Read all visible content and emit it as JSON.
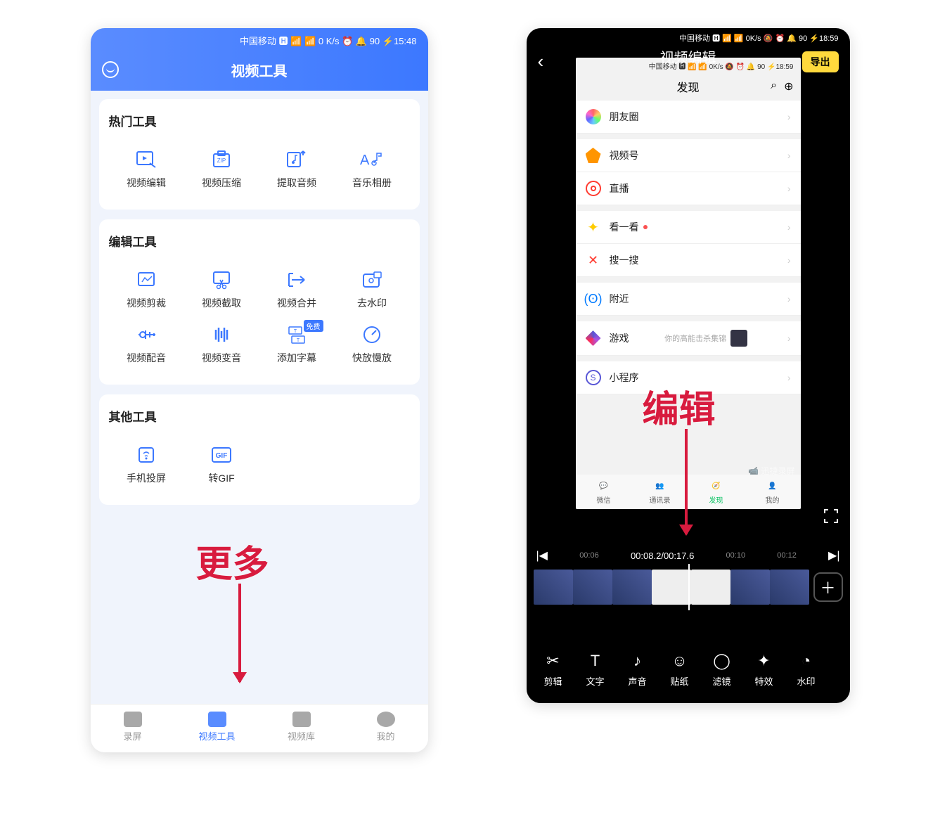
{
  "left": {
    "status_bar": "中国移动 🅷 📶 📶 0 K/s    ⏰ 🔔 90 ⚡15:48",
    "header_title": "视频工具",
    "sections": [
      {
        "title": "热门工具",
        "items": [
          {
            "label": "视频编辑",
            "icon": "video-edit"
          },
          {
            "label": "视频压缩",
            "icon": "zip"
          },
          {
            "label": "提取音频",
            "icon": "music-extract"
          },
          {
            "label": "音乐相册",
            "icon": "album"
          }
        ]
      },
      {
        "title": "编辑工具",
        "items": [
          {
            "label": "视频剪裁",
            "icon": "crop"
          },
          {
            "label": "视频截取",
            "icon": "cut"
          },
          {
            "label": "视频合并",
            "icon": "merge"
          },
          {
            "label": "去水印",
            "icon": "watermark"
          },
          {
            "label": "视频配音",
            "icon": "dub"
          },
          {
            "label": "视频变音",
            "icon": "voice"
          },
          {
            "label": "添加字幕",
            "icon": "subtitle",
            "badge": "免费"
          },
          {
            "label": "快放慢放",
            "icon": "speed"
          }
        ]
      },
      {
        "title": "其他工具",
        "items": [
          {
            "label": "手机投屏",
            "icon": "cast"
          },
          {
            "label": "转GIF",
            "icon": "gif"
          }
        ]
      }
    ],
    "annotation": "更多",
    "bottom_nav": [
      {
        "label": "录屏",
        "active": false
      },
      {
        "label": "视频工具",
        "active": true
      },
      {
        "label": "视频库",
        "active": false
      },
      {
        "label": "我的",
        "active": false
      }
    ]
  },
  "right": {
    "status_bar": "中国移动 🅷 📶 📶 0K/s 🔕 ⏰ 🔔 90 ⚡18:59",
    "header_title": "视频编辑",
    "export_label": "导出",
    "preview": {
      "wx_header": "发现",
      "items": [
        {
          "label": "朋友圈",
          "color": "linear-gradient(45deg,#f66,#6cf,#6f6,#fc6)"
        },
        {
          "label": "视频号",
          "color": "#ff9500"
        },
        {
          "label": "直播",
          "color": "#ff3b30"
        },
        {
          "label": "看一看",
          "color": "#ffcc00",
          "dot": true
        },
        {
          "label": "搜一搜",
          "color": "#ff3b30"
        },
        {
          "label": "附近",
          "color": "#007aff"
        },
        {
          "label": "游戏",
          "color": "#5856d6",
          "side": "你的高能击杀集锦",
          "thumb": true
        },
        {
          "label": "小程序",
          "color": "#5856d6"
        }
      ],
      "watermark": "📹 迅捷录屏",
      "bottom_nav": [
        {
          "label": "微信"
        },
        {
          "label": "通讯录"
        },
        {
          "label": "发现",
          "active": true
        },
        {
          "label": "我的"
        }
      ]
    },
    "timeline": {
      "prev_marks": [
        "00:06"
      ],
      "current": "00:08.2",
      "total": "00:17.6",
      "next_marks": [
        "00:10",
        "00:12"
      ]
    },
    "annotation": "编辑",
    "editor_tools": [
      {
        "label": "剪辑",
        "glyph": "✂"
      },
      {
        "label": "文字",
        "glyph": "T"
      },
      {
        "label": "声音",
        "glyph": "♪"
      },
      {
        "label": "贴纸",
        "glyph": "☺"
      },
      {
        "label": "滤镜",
        "glyph": "◯"
      },
      {
        "label": "特效",
        "glyph": "✦"
      },
      {
        "label": "水印",
        "glyph": "◔"
      }
    ]
  }
}
